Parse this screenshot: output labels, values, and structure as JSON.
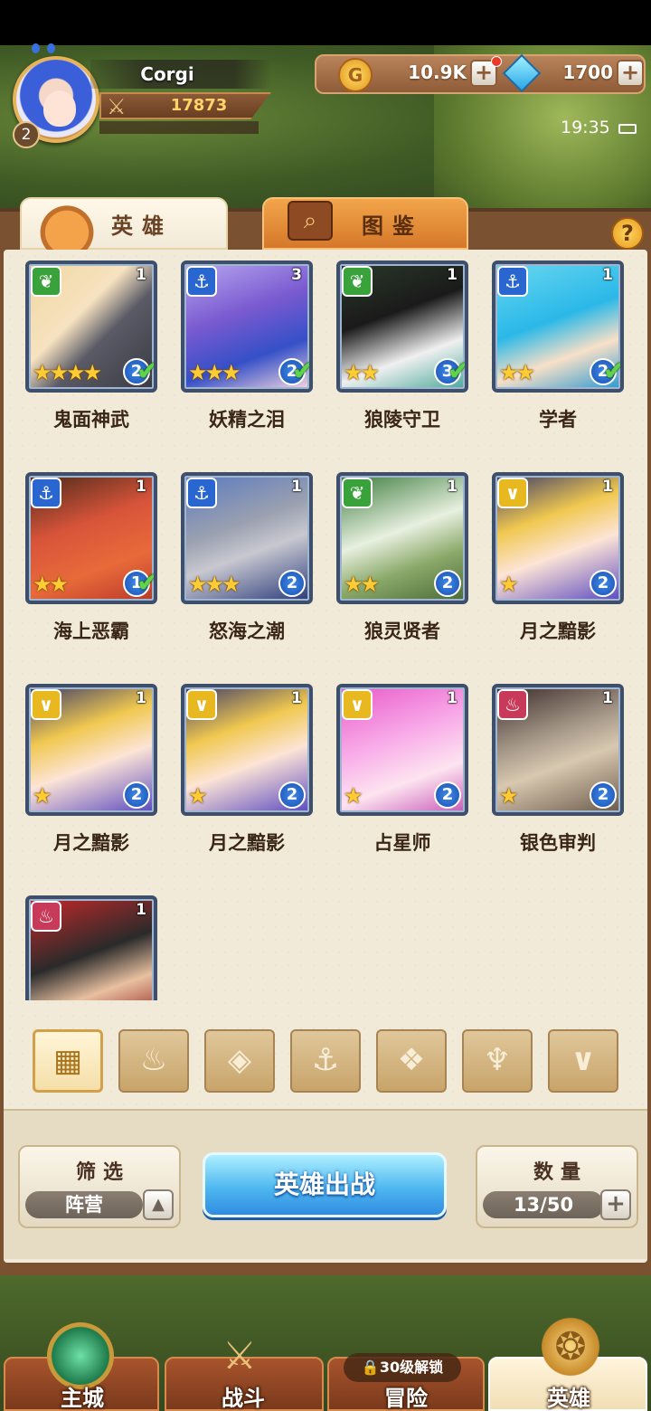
{
  "player": {
    "name": "Corgi",
    "level": "2",
    "power": "17873"
  },
  "currency": {
    "gold": "10.9K",
    "gems": "1700",
    "plus": "+"
  },
  "status": {
    "time": "19:35"
  },
  "tabs": {
    "heroes": "英雄",
    "codex": "图鉴",
    "help": "?"
  },
  "heroes": [
    {
      "name": "鬼面神武",
      "faction": "beast",
      "count": "1",
      "stars": "★★★★",
      "rank": "2",
      "ready": true
    },
    {
      "name": "妖精之泪",
      "faction": "anchor",
      "count": "3",
      "stars": "★★★",
      "rank": "2",
      "ready": true
    },
    {
      "name": "狼陵守卫",
      "faction": "beast",
      "count": "1",
      "stars": "★★",
      "rank": "3",
      "ready": true
    },
    {
      "name": "学者",
      "faction": "anchor",
      "count": "1",
      "stars": "★★",
      "rank": "2",
      "ready": true
    },
    {
      "name": "海上恶霸",
      "faction": "anchor",
      "count": "1",
      "stars": "★★",
      "rank": "1",
      "ready": true
    },
    {
      "name": "怒海之潮",
      "faction": "anchor",
      "count": "1",
      "stars": "★★★",
      "rank": "2",
      "ready": false
    },
    {
      "name": "狼灵贤者",
      "faction": "beast",
      "count": "1",
      "stars": "★★",
      "rank": "2",
      "ready": false
    },
    {
      "name": "月之黯影",
      "faction": "moon",
      "count": "1",
      "stars": "★",
      "rank": "2",
      "ready": false
    },
    {
      "name": "月之黯影",
      "faction": "moon",
      "count": "1",
      "stars": "★",
      "rank": "2",
      "ready": false
    },
    {
      "name": "月之黯影",
      "faction": "moon",
      "count": "1",
      "stars": "★",
      "rank": "2",
      "ready": false
    },
    {
      "name": "占星师",
      "faction": "moon",
      "count": "1",
      "stars": "★",
      "rank": "2",
      "ready": false
    },
    {
      "name": "银色审判",
      "faction": "flame",
      "count": "1",
      "stars": "★",
      "rank": "2",
      "ready": false
    },
    {
      "name": "",
      "faction": "flame",
      "count": "1",
      "stars": "",
      "rank": "",
      "ready": false
    }
  ],
  "faction_filters": [
    {
      "name": "all-factions",
      "glyph": "▦"
    },
    {
      "name": "flame-faction",
      "glyph": "♨"
    },
    {
      "name": "crystal-faction",
      "glyph": "◈"
    },
    {
      "name": "anchor-faction",
      "glyph": "⚓"
    },
    {
      "name": "beast-faction",
      "glyph": "❖"
    },
    {
      "name": "horn-faction",
      "glyph": "♆"
    },
    {
      "name": "moon-faction",
      "glyph": "∨"
    }
  ],
  "controls": {
    "filter_title": "筛选",
    "filter_value": "阵营",
    "deploy": "英雄出战",
    "quantity_title": "数量",
    "quantity_value": "13/50"
  },
  "nav": {
    "main_city": "主城",
    "battle": "战斗",
    "adventure": "冒险",
    "adventure_lock": "30级解锁",
    "heroes": "英雄"
  },
  "colors": {
    "beast": "#3aa23a",
    "anchor": "#2a66d0",
    "moon": "#e8b820",
    "flame": "#c83a5a"
  }
}
